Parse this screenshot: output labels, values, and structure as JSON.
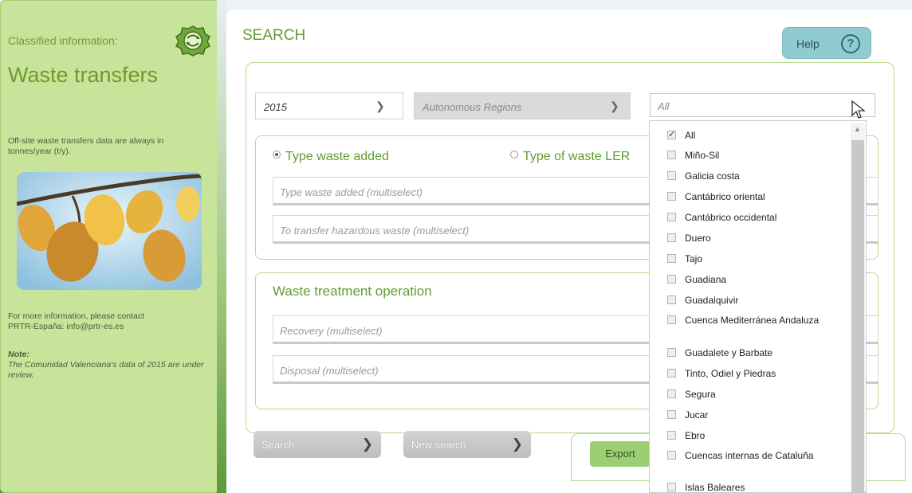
{
  "sidebar": {
    "caption": "Classified information:",
    "title": "Waste transfers",
    "units_note": "Off-site waste transfers data are always in tonnes/year (t/y).",
    "contact_line1": "For more information, please contact",
    "contact_line2": "PRTR-España: info@prtr-es.es",
    "note_title": "Note:",
    "note_text": "The Comunidad Valenciana's data of 2015 are under review."
  },
  "header": {
    "title": "SEARCH",
    "help_label": "Help",
    "help_icon": "?"
  },
  "filters": {
    "year": "2015",
    "region_placeholder": "Autonomous Regions",
    "basin_value": "All"
  },
  "waste_type": {
    "option_added": "Type waste added",
    "option_ler": "Type of waste LER",
    "field_added": "Type waste added (multiselect)",
    "field_hazardous": "To transfer hazardous waste (multiselect)"
  },
  "treatment": {
    "title": "Waste treatment operation",
    "field_recovery": "Recovery (multiselect)",
    "field_disposal": "Disposal (multiselect)"
  },
  "actions": {
    "search": "Search",
    "new_search": "New search",
    "export": "Export"
  },
  "dropdown": {
    "items": [
      {
        "label": "All",
        "checked": true
      },
      {
        "label": "Miño-Sil",
        "checked": false
      },
      {
        "label": "Galicia costa",
        "checked": false
      },
      {
        "label": "Cantábrico oriental",
        "checked": false
      },
      {
        "label": "Cantábrico occidental",
        "checked": false
      },
      {
        "label": "Duero",
        "checked": false
      },
      {
        "label": "Tajo",
        "checked": false
      },
      {
        "label": "Guadiana",
        "checked": false
      },
      {
        "label": "Guadalquivir",
        "checked": false
      },
      {
        "label": "Cuenca Mediterránea Andaluza",
        "checked": false
      },
      {
        "label": "Guadalete y Barbate",
        "checked": false
      },
      {
        "label": "Tinto, Odiel y Piedras",
        "checked": false
      },
      {
        "label": "Segura",
        "checked": false
      },
      {
        "label": "Jucar",
        "checked": false
      },
      {
        "label": "Ebro",
        "checked": false
      },
      {
        "label": "Cuencas internas de Cataluña",
        "checked": false
      },
      {
        "label": "Islas Baleares",
        "checked": false
      }
    ]
  },
  "colors": {
    "accent_green": "#5f9d34",
    "sidebar_bg": "#c8e49a",
    "help_bg": "#8fcbd1",
    "export_bg": "#9ccf74"
  }
}
